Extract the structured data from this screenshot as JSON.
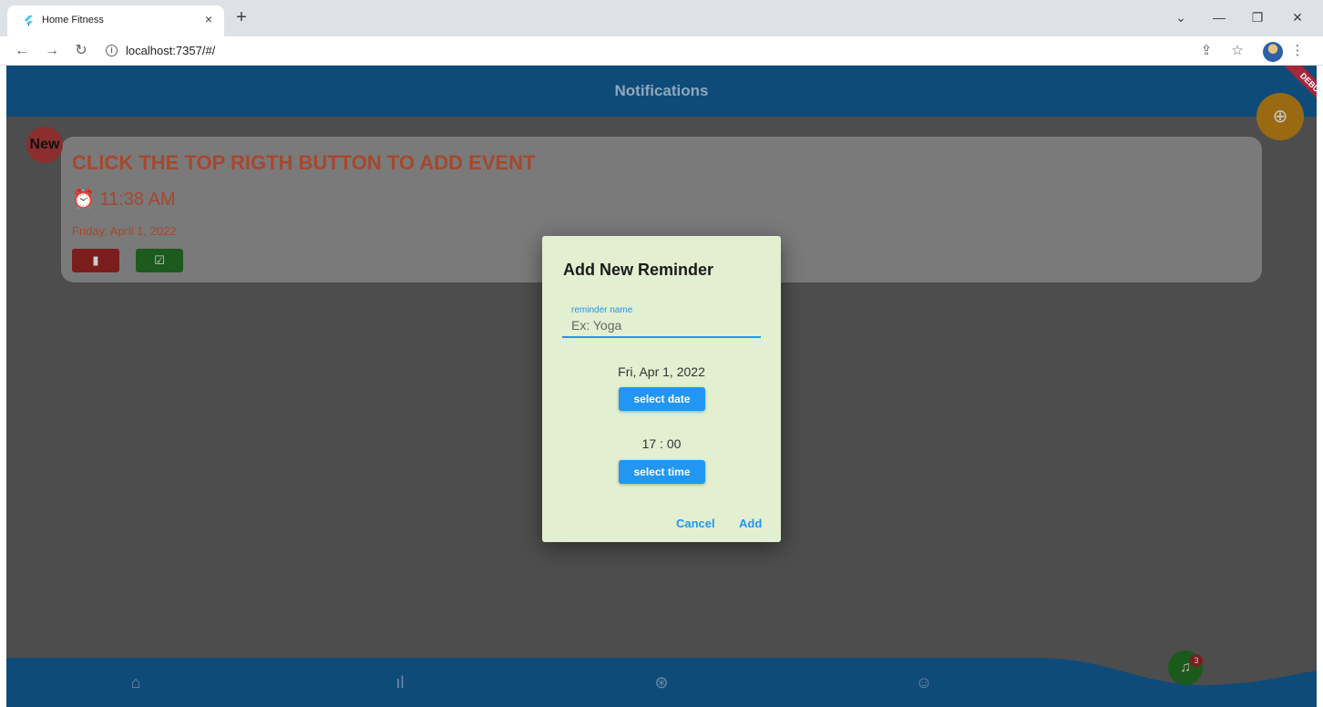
{
  "browser": {
    "tab_title": "Home Fitness",
    "tab_close": "×",
    "new_tab": "+",
    "url": "localhost:7357/#/",
    "minimize": "—",
    "restore": "❐",
    "close": "✕",
    "dropdown": "⌄"
  },
  "appbar": {
    "title": "Notifications",
    "debug": "DEBUG"
  },
  "reminder_card": {
    "badge": "New",
    "title": "CLICK THE TOP RIGTH BUTTON TO ADD EVENT",
    "time": "11:38 AM",
    "date": "Friday, April 1, 2022"
  },
  "dialog": {
    "title": "Add New Reminder",
    "field_label": "reminder name",
    "field_placeholder": "Ex: Yoga",
    "date_value": "Fri, Apr 1, 2022",
    "select_date_label": "select date",
    "time_value": "17 : 00",
    "select_time_label": "select time",
    "cancel_label": "Cancel",
    "add_label": "Add"
  },
  "bottom_nav": {
    "items": [
      "home-icon",
      "stats-icon",
      "activity-icon",
      "profile-icon"
    ],
    "notification_count": "3"
  },
  "colors": {
    "appbar": "#0f4b79",
    "card_text": "#a5482e",
    "dialog_bg": "#e2efd0",
    "accent": "#2196f3"
  }
}
